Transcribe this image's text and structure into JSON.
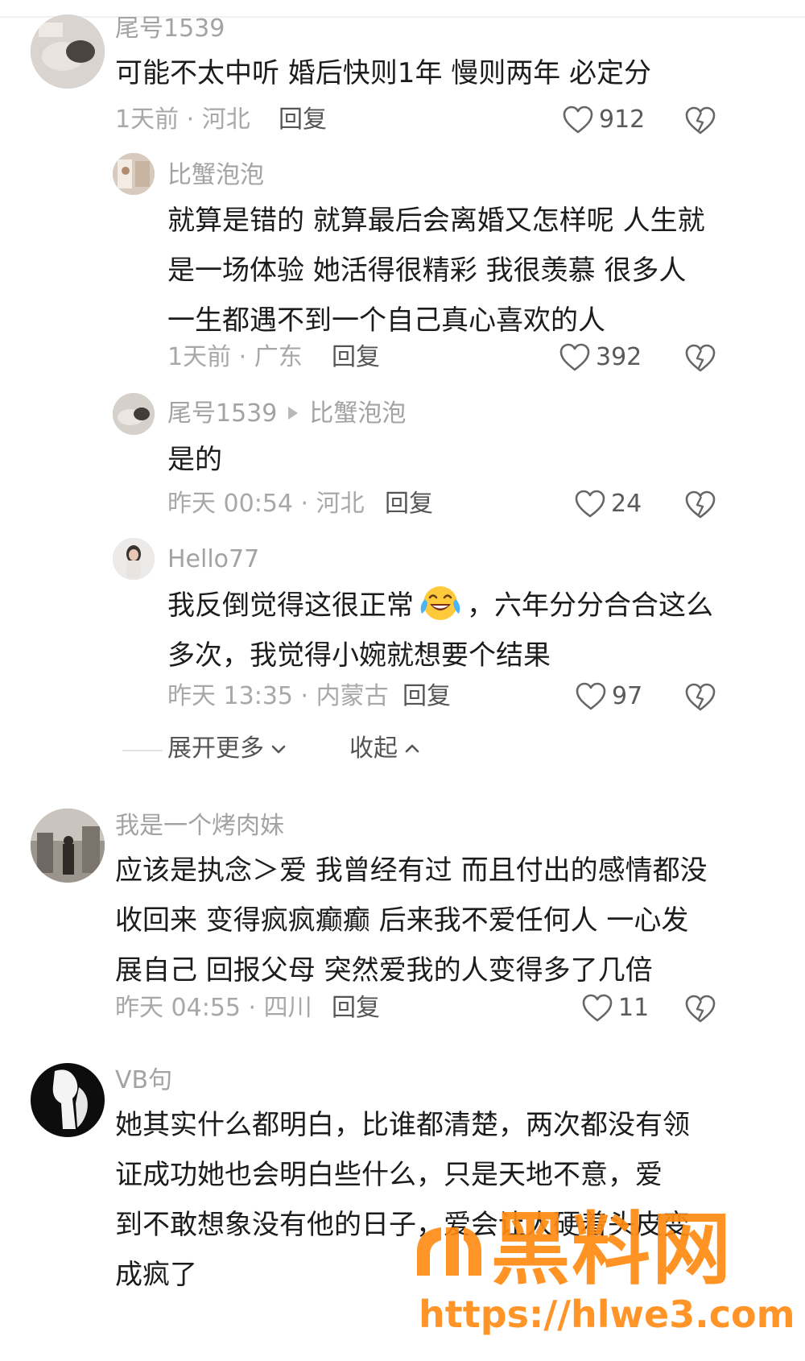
{
  "comments": [
    {
      "user": "尾号1539",
      "text": [
        "可能不太中听 婚后快则1年 慢则两年 必定分"
      ],
      "meta": "1天前 · 河北",
      "reply": "回复",
      "likes": "912"
    },
    {
      "user": "比蟹泡泡",
      "text": [
        "就算是错的 就算最后会离婚又怎样呢 人生就",
        "是一场体验 她活得很精彩 我很羡慕 很多人",
        "一生都遇不到一个自己真心喜欢的人"
      ],
      "meta": "1天前 · 广东",
      "reply": "回复",
      "likes": "392"
    },
    {
      "user": "尾号1539",
      "reply_to": "比蟹泡泡",
      "text": [
        "是的"
      ],
      "meta": "昨天 00:54 · 河北",
      "reply": "回复",
      "likes": "24"
    },
    {
      "user": "Hello77",
      "text_before_emoji": "我反倒觉得这很正常",
      "emoji": "tears-of-joy-emoji",
      "text_after_emoji": "，六年分分合合这么",
      "text_line2": "多次，我觉得小婉就想要个结果",
      "meta": "昨天 13:35 · 内蒙古",
      "reply": "回复",
      "likes": "97"
    },
    {
      "user": "我是一个烤肉妹",
      "text": [
        "应该是执念＞爱 我曾经有过 而且付出的感情都没",
        "收回来 变得疯疯癫癫 后来我不爱任何人 一心发",
        "展自己 回报父母 突然爱我的人变得多了几倍"
      ],
      "meta": "昨天 04:55 · 四川",
      "reply": "回复",
      "likes": "11"
    },
    {
      "user": "VB句",
      "text": [
        "她其实什么都明白，比谁都清楚，两次都没有领",
        "证成功她也会明白些什么，只是天地不意，爱",
        "到不敢想象没有他的日子，爱会让人硬着头皮变",
        "成疯了"
      ]
    }
  ],
  "expand": {
    "more_label": "展开更多",
    "collapse_label": "收起"
  },
  "watermark": {
    "title": "黑料网",
    "url": "https://hlwe3.com"
  },
  "colors": {
    "text": "#1c1c1c",
    "meta": "#a8a8a8",
    "username": "#a3a3a3",
    "watermark": "#ff8a12"
  }
}
